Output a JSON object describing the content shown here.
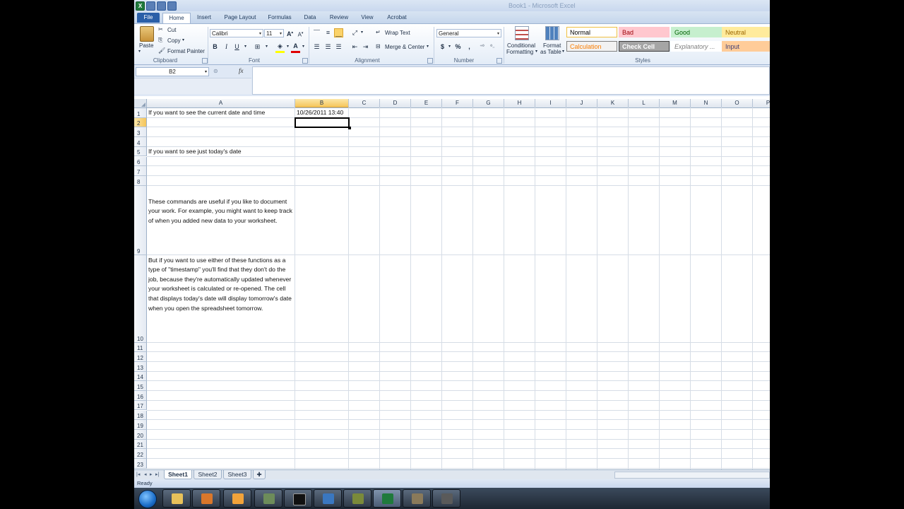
{
  "window": {
    "title": "Book1 - Microsoft Excel"
  },
  "ribbon_tabs": [
    "File",
    "Home",
    "Insert",
    "Page Layout",
    "Formulas",
    "Data",
    "Review",
    "View",
    "Acrobat"
  ],
  "clipboard": {
    "paste": "Paste",
    "cut": "Cut",
    "copy": "Copy",
    "format_painter": "Format Painter",
    "label": "Clipboard"
  },
  "font": {
    "name": "Calibri",
    "size": "11",
    "bold": "B",
    "italic": "I",
    "underline": "U",
    "label": "Font"
  },
  "alignment": {
    "wrap_text": "Wrap Text",
    "merge_center": "Merge & Center",
    "label": "Alignment"
  },
  "number": {
    "format": "General",
    "currency": "$",
    "percent": "%",
    "comma": ",",
    "label": "Number"
  },
  "styles": {
    "conditional": "Conditional",
    "conditional2": "Formatting",
    "format_as": "Format",
    "format_as2": "as Table",
    "label": "Styles",
    "cells": [
      {
        "text": "Normal",
        "bg": "#ffffff",
        "fg": "#000000",
        "border": "#f0c040"
      },
      {
        "text": "Bad",
        "bg": "#ffc7ce",
        "fg": "#9c0006",
        "border": "#ffc7ce"
      },
      {
        "text": "Good",
        "bg": "#c6efce",
        "fg": "#006100",
        "border": "#c6efce"
      },
      {
        "text": "Neutral",
        "bg": "#ffeb9c",
        "fg": "#9c6500",
        "border": "#ffeb9c"
      },
      {
        "text": "Calculation",
        "bg": "#f2f2f2",
        "fg": "#fa7d00",
        "border": "#7f7f7f"
      },
      {
        "text": "Check Cell",
        "bg": "#a5a5a5",
        "fg": "#ffffff",
        "border": "#3f3f3f"
      },
      {
        "text": "Explanatory ...",
        "bg": "#ffffff",
        "fg": "#7f7f7f",
        "border": "#ffffff"
      },
      {
        "text": "Input",
        "bg": "#ffcc99",
        "fg": "#3f3f76",
        "border": "#ffcc99"
      }
    ]
  },
  "formula_bar": {
    "name_box": "B2",
    "fx": "fx",
    "value": ""
  },
  "columns": [
    "A",
    "B",
    "C",
    "D",
    "E",
    "F",
    "G",
    "H",
    "I",
    "J",
    "K",
    "L",
    "M",
    "N",
    "O",
    "P"
  ],
  "rows": [
    "1",
    "2",
    "3",
    "4",
    "5",
    "6",
    "7",
    "8",
    "9",
    "10",
    "11",
    "12",
    "13",
    "14",
    "15",
    "16",
    "17",
    "18",
    "19",
    "20",
    "21",
    "22",
    "23"
  ],
  "cells": {
    "A1": "If you want to see the current date and time",
    "B1": "10/26/2011 13:40",
    "A5": "If you want to see just today's date",
    "A9": "These commands are useful if you like to document your work. For example, you might want to keep track of when you added new data to your worksheet.",
    "A10": "But if you want to use either of these functions as a type of \"timestamp\" you'll find that they don't do the job, because they're automatically updated whenever your worksheet is calculated or re-opened. The cell that displays today's date will display tomorrow's date when you open the spreadsheet tomorrow."
  },
  "active_cell": "B2",
  "sheets": [
    "Sheet1",
    "Sheet2",
    "Sheet3"
  ],
  "status": {
    "text": "Ready"
  },
  "colors": {
    "accent": "#2a5fa8",
    "select": "#f5c55a"
  }
}
